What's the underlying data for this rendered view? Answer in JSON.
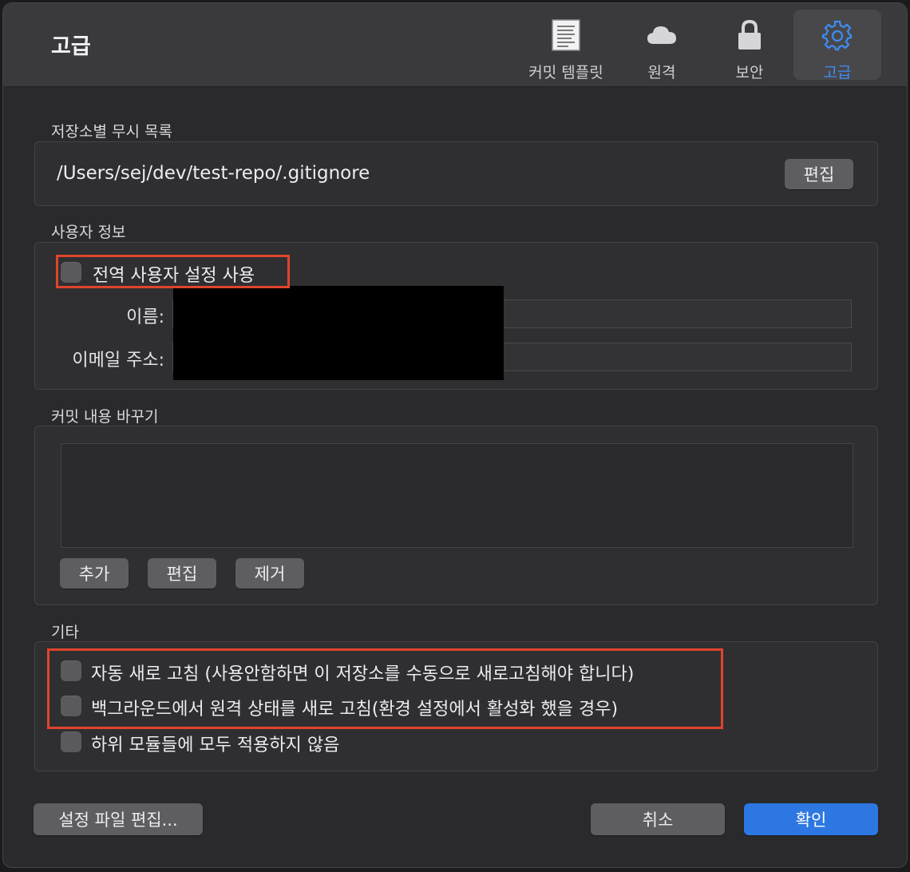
{
  "window": {
    "title": "고급"
  },
  "toolbar": {
    "tabs": [
      {
        "label": "커밋 템플릿",
        "icon": "document-icon"
      },
      {
        "label": "원격",
        "icon": "cloud-icon"
      },
      {
        "label": "보안",
        "icon": "lock-icon"
      },
      {
        "label": "고급",
        "icon": "gear-icon",
        "selected": true
      }
    ]
  },
  "ignore_list": {
    "label": "저장소별 무시 목록",
    "path": "/Users/sej/dev/test-repo/.gitignore",
    "edit_label": "편집"
  },
  "user_info": {
    "label": "사용자 정보",
    "use_global_label": "전역 사용자 설정 사용",
    "use_global_checked": false,
    "name_label": "이름:",
    "email_label": "이메일 주소:"
  },
  "commit_replace": {
    "label": "커밋 내용 바꾸기",
    "add_label": "추가",
    "edit_label": "편집",
    "remove_label": "제거"
  },
  "misc": {
    "label": "기타",
    "options": [
      {
        "label": "자동 새로 고침 (사용안함하면 이 저장소를 수동으로 새로고침해야 합니다)",
        "checked": false
      },
      {
        "label": "백그라운드에서 원격 상태를 새로 고침(환경 설정에서 활성화 했을 경우)",
        "checked": false
      },
      {
        "label": "하위 모듈들에 모두 적용하지 않음",
        "checked": false
      }
    ]
  },
  "footer": {
    "edit_config_label": "설정 파일 편집...",
    "cancel_label": "취소",
    "ok_label": "확인"
  },
  "colors": {
    "accent": "#2d77e2",
    "selected_tab_text": "#3d8df5",
    "annotation": "#e0442c"
  }
}
